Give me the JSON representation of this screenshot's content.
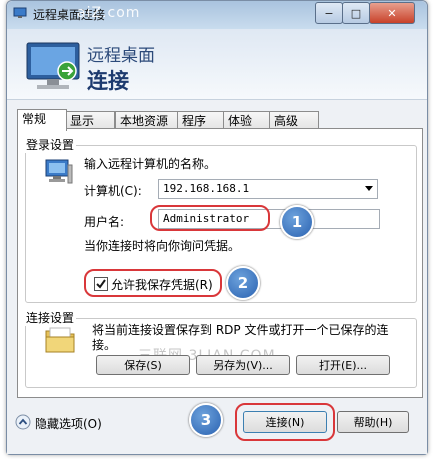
{
  "window": {
    "title": "远程桌面连接",
    "header_line1": "远程桌面",
    "header_line2": "连接",
    "minimize": "−",
    "maximize": "□",
    "close": "✕"
  },
  "tabs": [
    {
      "label": "常规",
      "active": true
    },
    {
      "label": "显示"
    },
    {
      "label": "本地资源"
    },
    {
      "label": "程序"
    },
    {
      "label": "体验"
    },
    {
      "label": "高级"
    }
  ],
  "login": {
    "group_label": "登录设置",
    "instruction": "输入远程计算机的名称。",
    "computer_label": "计算机(C):",
    "computer_value": "192.168.168.1",
    "username_label": "用户名:",
    "username_value": "Administrator",
    "note": "当你连接时将向你询问凭据。",
    "allow_save_label": "允许我保存凭据(R)",
    "allow_save_checked": true
  },
  "connection": {
    "group_label": "连接设置",
    "text": "将当前连接设置保存到 RDP 文件或打开一个已保存的连接。",
    "save_button": "保存(S)",
    "save_as_button": "另存为(V)...",
    "open_button": "打开(E)..."
  },
  "footer": {
    "hide_options": "隐藏选项(O)",
    "connect_button": "连接(N)",
    "help_button": "帮助(H)"
  },
  "annotations": {
    "badge1": "1",
    "badge2": "2",
    "badge3": "3"
  },
  "watermarks": {
    "top": "aiZ.com",
    "middle": "三联网 3LIAN.COM"
  },
  "colors": {
    "accent_red": "#d9373a",
    "badge_blue": "#2a62b1",
    "header_text": "#1d3a6e"
  }
}
